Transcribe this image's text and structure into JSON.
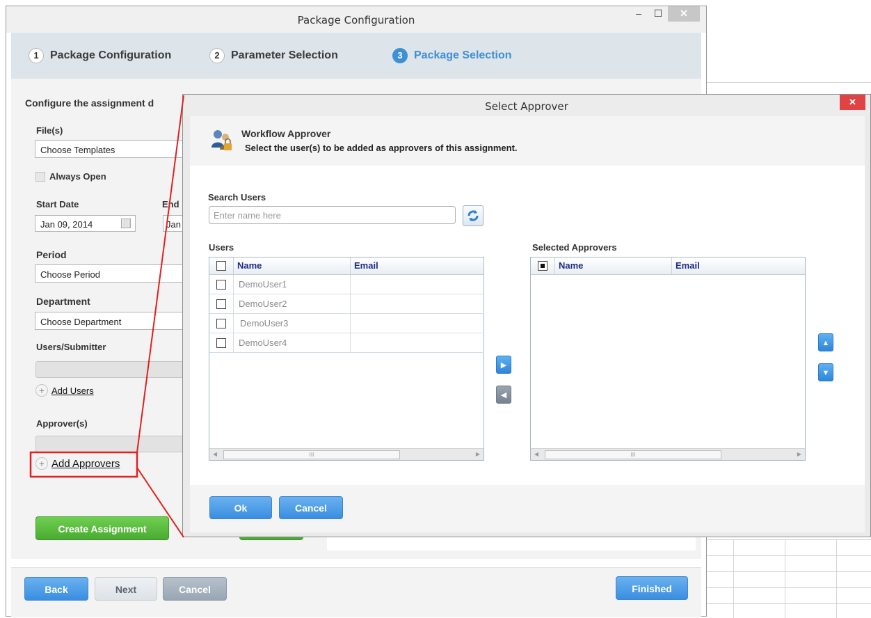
{
  "window": {
    "title": "Package Configuration",
    "minimize": "–",
    "maximize": "☐",
    "close": "✕"
  },
  "wizard": {
    "steps": [
      {
        "num": "1",
        "label": "Package Configuration"
      },
      {
        "num": "2",
        "label": "Parameter Selection"
      },
      {
        "num": "3",
        "label": "Package Selection"
      }
    ],
    "active_step": 3
  },
  "config": {
    "heading": "Configure the assignment d",
    "files_label": "File(s)",
    "files_value": "Choose Templates",
    "always_open": "Always Open",
    "start_date_label": "Start Date",
    "start_date_value": "Jan 09, 2014",
    "end_date_label": "End I",
    "end_date_value": "Jan",
    "period_label": "Period",
    "period_value": "Choose Period",
    "department_label": "Department",
    "department_value": "Choose Department",
    "users_label": "Users/Submitter",
    "add_users": "Add Users",
    "approvers_label": "Approver(s)",
    "add_approvers": "Add Approvers",
    "create_assignment": "Create Assignment"
  },
  "footer": {
    "back": "Back",
    "next": "Next",
    "cancel": "Cancel",
    "finished": "Finished"
  },
  "dialog": {
    "title": "Select Approver",
    "close": "✕",
    "header_title": "Workflow Approver",
    "header_subtitle": "Select the user(s) to be added as approvers of this assignment.",
    "search_label": "Search Users",
    "search_placeholder": "Enter name here",
    "users_title": "Users",
    "selected_title": "Selected Approvers",
    "col_name": "Name",
    "col_email": "Email",
    "users": [
      "DemoUser1",
      "DemoUser2",
      "DemoUser3",
      "DemoUser4"
    ],
    "scroll_grip": "III",
    "ok": "Ok",
    "cancel": "Cancel"
  },
  "colors": {
    "accent_blue": "#3d8fd6",
    "green": "#49ab31",
    "callout_red": "#e02020"
  }
}
